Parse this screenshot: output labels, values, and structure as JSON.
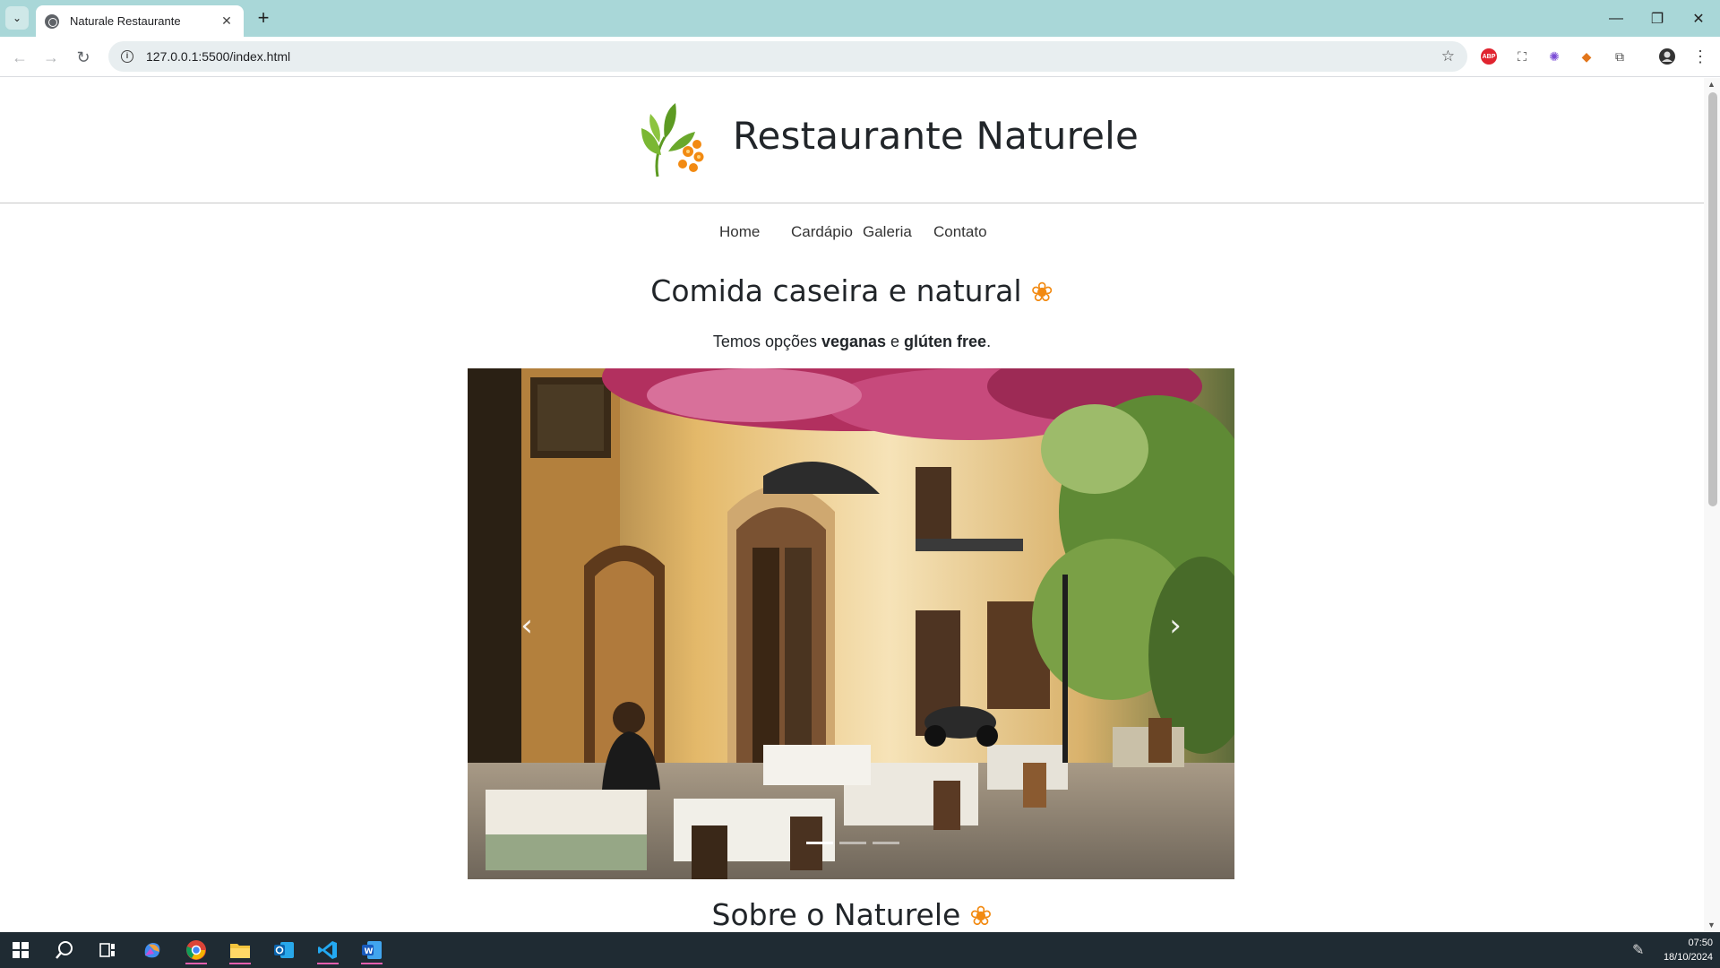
{
  "browser": {
    "tab_title": "Naturale Restaurante",
    "url": "127.0.0.1:5500/index.html",
    "new_tab": "+",
    "tab_close": "✕",
    "window": {
      "minimize": "—",
      "restore": "❐",
      "close": "✕"
    },
    "nav": {
      "back": "←",
      "forward": "→",
      "reload": "↻"
    },
    "extensions": [
      "adblock-icon",
      "screenshot-icon",
      "flower-extension-icon",
      "metamask-icon",
      "puzzle-icon",
      "profile-icon",
      "menu-icon"
    ],
    "abp_label": "ABP"
  },
  "site": {
    "brand": "Restaurante Naturele",
    "nav": [
      "Home",
      "Cardápio",
      "Galeria",
      "Contato"
    ],
    "headline": "Comida caseira e natural",
    "flower_glyph": "❀",
    "subline_prefix": "Temos opções ",
    "subline_bold1": "veganas",
    "subline_mid": " e ",
    "subline_bold2": "glúten free",
    "subline_suffix": ".",
    "carousel": {
      "prev": "‹",
      "next": "›",
      "indicators": 3,
      "active_index": 0
    },
    "section_title": "Sobre o Naturele"
  },
  "taskbar": {
    "apps": [
      "windows-start-icon",
      "search-icon",
      "task-view-icon",
      "copilot-icon",
      "chrome-icon",
      "file-explorer-icon",
      "outlook-icon",
      "vscode-icon",
      "word-icon"
    ],
    "time": "07:50",
    "date": "18/10/2024"
  },
  "colors": {
    "tabbar": "#a9d7d8",
    "accent_orange": "#f28a12",
    "leaf_green": "#6aa82c"
  }
}
